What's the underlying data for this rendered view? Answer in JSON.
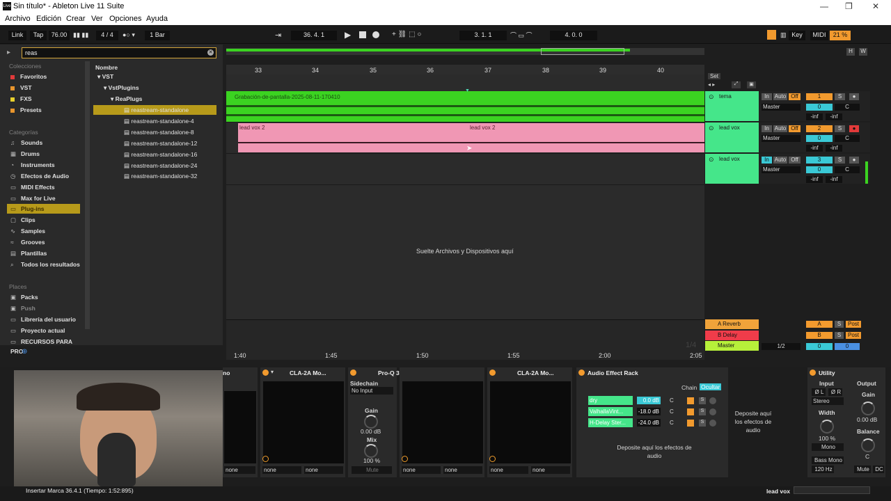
{
  "window": {
    "title": "Sin título* - Ableton Live 11 Suite",
    "app_icon": "Live"
  },
  "menu": [
    "Archivo",
    "Edición",
    "Crear",
    "Ver",
    "Opciones",
    "Ayuda"
  ],
  "control_bar": {
    "link": "Link",
    "tap": "Tap",
    "tempo": "76.00",
    "signature": "4 / 4",
    "quantize": "1 Bar",
    "position": "36.  4.  1",
    "loop_start": "3.  1.  1",
    "loop_length": "4.  0.  0",
    "key": "Key",
    "midi": "MIDI",
    "cpu": "21 %"
  },
  "browser": {
    "search": "reas",
    "colecciones_head": "Colecciones",
    "colecciones": [
      {
        "label": "Favoritos",
        "color": "#e23a3a"
      },
      {
        "label": "VST",
        "color": "#e8952d"
      },
      {
        "label": "FXS",
        "color": "#e8d02d"
      },
      {
        "label": "Presets",
        "color": "#e8952d"
      }
    ],
    "categorias_head": "Categorías",
    "categorias": [
      "Sounds",
      "Drums",
      "Instruments",
      "Efectos de Audio",
      "MIDI Effects",
      "Max for Live",
      "Plug-ins",
      "Clips",
      "Samples",
      "Grooves",
      "Plantillas",
      "Todos los resultados"
    ],
    "places_head": "Places",
    "places": [
      "Packs",
      "Push",
      "Librería del usuario",
      "Proyecto actual",
      "RECURSOS PARA PRO"
    ],
    "name_head": "Nombre",
    "tree": [
      "VST",
      "VstPlugins",
      "ReaPlugs"
    ],
    "items": [
      "reastream-standalone",
      "reastream-standalone-4",
      "reastream-standalone-8",
      "reastream-standalone-12",
      "reastream-standalone-16",
      "reastream-standalone-24",
      "reastream-standalone-32"
    ]
  },
  "arrangement": {
    "bars": [
      "33",
      "34",
      "35",
      "36",
      "37",
      "38",
      "39",
      "40"
    ],
    "set_label": "Set",
    "clip1": "Grabación-de-pantalla-2025-08-11-170410",
    "clip2a": "lead vox 2",
    "clip2b": "lead vox 2",
    "drop_text": "Suelte Archivos y Dispositivos aquí",
    "timeline": [
      "1:40",
      "1:45",
      "1:50",
      "1:55",
      "2:00",
      "2:05"
    ],
    "fraction": "1/4"
  },
  "tracks": [
    {
      "name": "tema",
      "num": "1",
      "vol": "0",
      "pan": "C",
      "route": "Master",
      "inf1": "-inf",
      "inf2": "-inf"
    },
    {
      "name": "lead vox",
      "num": "2",
      "vol": "0",
      "pan": "C",
      "route": "Master",
      "inf1": "-inf",
      "inf2": "-inf"
    },
    {
      "name": "lead vox",
      "num": "3",
      "vol": "0",
      "pan": "C",
      "route": "Master",
      "inf1": "-inf",
      "inf2": "-inf"
    }
  ],
  "io": {
    "in": "In",
    "auto": "Auto",
    "off": "Off",
    "s": "S"
  },
  "returns": [
    {
      "name": "A Reverb",
      "letter": "A",
      "post": "Post",
      "color": "#f0a33a"
    },
    {
      "name": "B Delay",
      "letter": "B",
      "post": "Post",
      "color": "#f03c4a"
    },
    {
      "name": "Master",
      "letter": "0",
      "post": "0",
      "color": "#b7f03a"
    }
  ],
  "master_div": "1/2",
  "devices": {
    "cla1": "CLA-2A Mo...",
    "proq": "Pro-Q 3",
    "cla2": "CLA-2A Mo...",
    "rack": "Audio Effect Rack",
    "utility": "Utility",
    "sidechain": "Sidechain",
    "no_input": "No Input",
    "gain": "Gain",
    "gain_val": "0.00 dB",
    "mix": "Mix",
    "mix_val": "100 %",
    "mute": "Mute",
    "none": "none",
    "chain": "Chain",
    "ocultar": "Ocultar",
    "chains": [
      {
        "name": "dry",
        "val": "0.0 dB"
      },
      {
        "name": "ValhallaVint...",
        "val": "-18.0 dB"
      },
      {
        "name": "H-Delay Ster...",
        "val": "-24.0 dB"
      }
    ],
    "drop_fx": "Deposite aquí los efectos de audio",
    "drop_fx2": "Deposite aquí los efectos de audio",
    "u_input": "Input",
    "u_output": "Output",
    "u_gain": "Gain",
    "u_gain_val": "0.00 dB",
    "u_stereo": "Stereo",
    "u_width": "Width",
    "u_width_val": "100 %",
    "u_mono": "Mono",
    "u_balance": "Balance",
    "u_c": "C",
    "u_bass": "Bass Mono",
    "u_hz": "120 Hz",
    "u_mute": "Mute",
    "u_dc": "DC",
    "u_phase_l": "Ø L",
    "u_phase_r": "Ø R",
    "hidden_label": "no"
  },
  "status": {
    "left": "Insertar Marca 36.4.1 (Tiempo: 1:52:895)",
    "right": "lead vox"
  }
}
